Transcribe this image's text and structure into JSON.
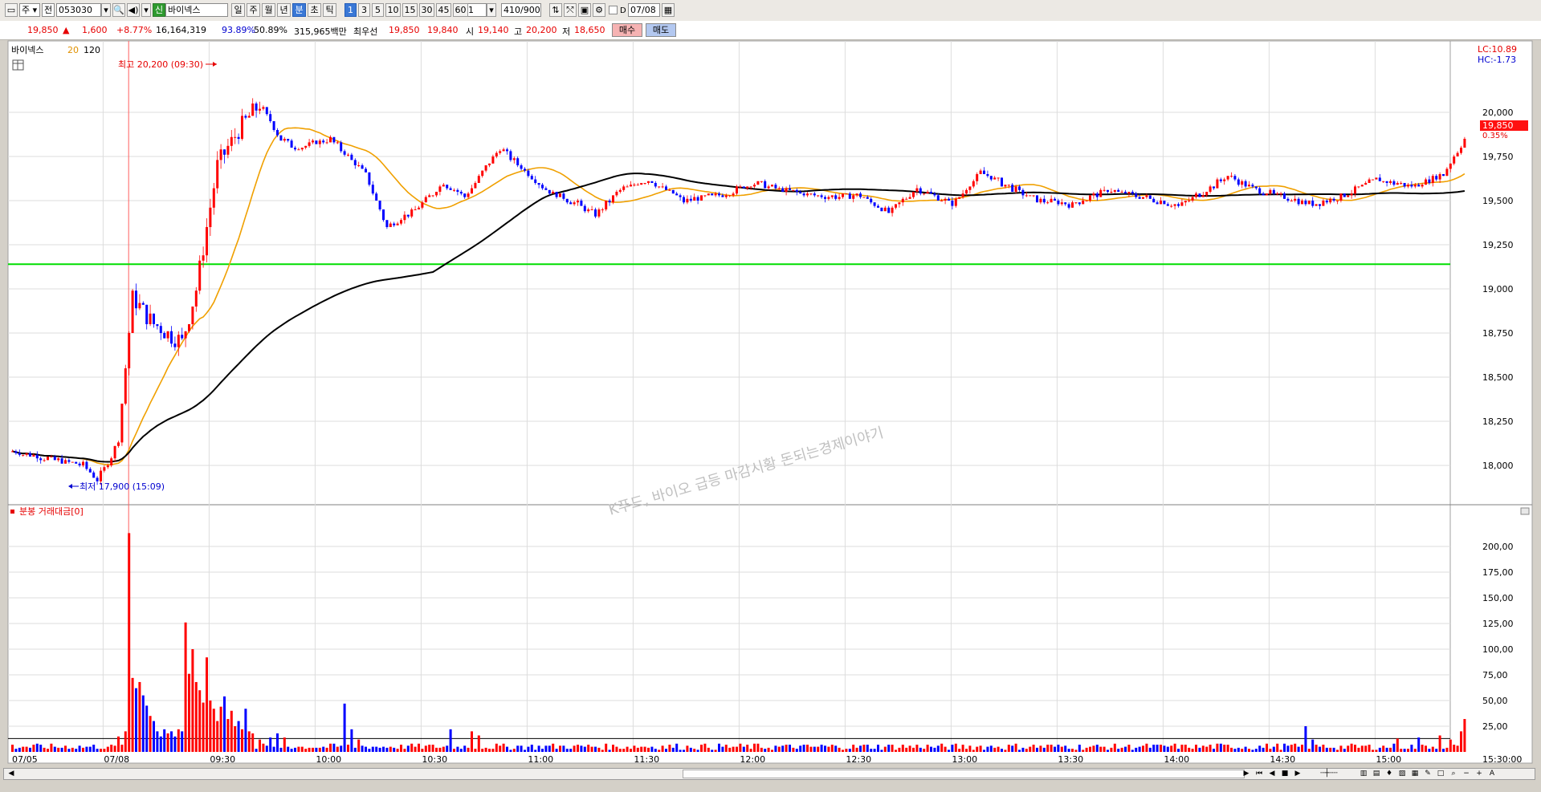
{
  "toolbar": {
    "market": "주",
    "type": "전",
    "code": "053030",
    "badge": "신",
    "name": "바이넥스",
    "periods": [
      "일",
      "주",
      "월",
      "년",
      "분",
      "초",
      "틱"
    ],
    "active_period": "분",
    "intervals": [
      "1",
      "3",
      "5",
      "10",
      "15",
      "30",
      "45",
      "60"
    ],
    "active_interval": "1",
    "unit_value": "1",
    "count": "410/900",
    "check_label": "D",
    "date": "07/08"
  },
  "info": {
    "price": "19,850",
    "arrow": "▲",
    "change": "1,600",
    "change_pct": "+8.77%",
    "volume": "16,164,319",
    "vol_ratio": "93.89%",
    "ratio2": "50.89%",
    "amount": "315,965백만",
    "bid_label": "최우선",
    "ask": "19,850",
    "bid": "19,840",
    "open_label": "시",
    "open": "19,140",
    "high_label": "고",
    "high": "20,200",
    "low_label": "저",
    "low": "18,650",
    "buy_label": "매수",
    "sell_label": "매도"
  },
  "legend": {
    "name": "바이넥스",
    "ma1": "20",
    "ma2": "120",
    "lc": "LC:10.89",
    "hc": "HC:-1.73",
    "cur_price": "19,850",
    "cur_pct": "0.35%"
  },
  "annotations": {
    "high": "최고 20,200 (09:30)",
    "low": "최저 17,900 (15:09)",
    "watermark": "K푸드, 바이오 급등 마감시황 돈되는경제이야기"
  },
  "volume_panel": {
    "title": "분봉 거래대금[0]"
  },
  "colors": {
    "up": "#ff0000",
    "down": "#0000ff",
    "ma20": "#f0a000",
    "ma120": "#000000",
    "hline": "#00dd00",
    "grid": "#dcdcdc"
  },
  "chart_data": {
    "type": "candlestick",
    "price_axis": {
      "ylim": [
        17850,
        20350
      ],
      "ticks": [
        18000,
        18250,
        18500,
        18750,
        19000,
        19250,
        19500,
        19750,
        20000
      ],
      "tick_labels": [
        "18,000",
        "18,250",
        "18,500",
        "18,750",
        "19,000",
        "19,250",
        "19,500",
        "19,750",
        "20,000"
      ]
    },
    "volume_axis": {
      "ylim": [
        0,
        225
      ],
      "ticks": [
        25,
        50,
        75,
        100,
        125,
        150,
        175,
        200
      ],
      "tick_labels": [
        "25,00",
        "50,00",
        "75,00",
        "100,00",
        "125,00",
        "150,00",
        "175,00",
        "200,00"
      ]
    },
    "x_labels": [
      "07/05",
      "07/08",
      "09:30",
      "10:00",
      "10:30",
      "11:00",
      "11:30",
      "12:00",
      "12:30",
      "13:00",
      "13:30",
      "14:00",
      "14:30",
      "15:00",
      "15:30:00"
    ],
    "horizontal_line": 19140,
    "volume_reference": 13,
    "price_path": [
      [
        0,
        18080
      ],
      [
        10,
        18040
      ],
      [
        20,
        18000
      ],
      [
        24,
        17920
      ],
      [
        28,
        18050
      ],
      [
        30,
        18150
      ],
      [
        34,
        18950
      ],
      [
        40,
        18800
      ],
      [
        48,
        18700
      ],
      [
        52,
        19000
      ],
      [
        58,
        19700
      ],
      [
        64,
        19900
      ],
      [
        70,
        20050
      ],
      [
        76,
        19850
      ],
      [
        80,
        19800
      ],
      [
        90,
        19850
      ],
      [
        100,
        19650
      ],
      [
        106,
        19350
      ],
      [
        114,
        19450
      ],
      [
        122,
        19600
      ],
      [
        128,
        19520
      ],
      [
        138,
        19800
      ],
      [
        146,
        19650
      ],
      [
        152,
        19550
      ],
      [
        160,
        19480
      ],
      [
        165,
        19420
      ],
      [
        172,
        19560
      ],
      [
        180,
        19620
      ],
      [
        190,
        19500
      ],
      [
        200,
        19530
      ],
      [
        210,
        19600
      ],
      [
        220,
        19550
      ],
      [
        230,
        19520
      ],
      [
        240,
        19530
      ],
      [
        248,
        19430
      ],
      [
        256,
        19570
      ],
      [
        266,
        19480
      ],
      [
        274,
        19660
      ],
      [
        282,
        19580
      ],
      [
        290,
        19500
      ],
      [
        300,
        19480
      ],
      [
        310,
        19560
      ],
      [
        320,
        19520
      ],
      [
        330,
        19470
      ],
      [
        338,
        19560
      ],
      [
        344,
        19640
      ],
      [
        352,
        19560
      ],
      [
        360,
        19520
      ],
      [
        368,
        19480
      ],
      [
        376,
        19520
      ],
      [
        386,
        19620
      ],
      [
        396,
        19580
      ],
      [
        405,
        19650
      ],
      [
        411,
        19850
      ]
    ],
    "volume_spikes": [
      {
        "bar": 30,
        "value": 15
      },
      {
        "bar": 32,
        "value": 20
      },
      {
        "bar": 33,
        "value": 213
      },
      {
        "bar": 34,
        "value": 72
      },
      {
        "bar": 35,
        "value": 62
      },
      {
        "bar": 36,
        "value": 68
      },
      {
        "bar": 37,
        "value": 55
      },
      {
        "bar": 38,
        "value": 45
      },
      {
        "bar": 39,
        "value": 35
      },
      {
        "bar": 40,
        "value": 30
      },
      {
        "bar": 41,
        "value": 20
      },
      {
        "bar": 42,
        "value": 15
      },
      {
        "bar": 43,
        "value": 22
      },
      {
        "bar": 44,
        "value": 18
      },
      {
        "bar": 45,
        "value": 20
      },
      {
        "bar": 46,
        "value": 15
      },
      {
        "bar": 47,
        "value": 22
      },
      {
        "bar": 48,
        "value": 20
      },
      {
        "bar": 49,
        "value": 126
      },
      {
        "bar": 50,
        "value": 76
      },
      {
        "bar": 51,
        "value": 100
      },
      {
        "bar": 52,
        "value": 68
      },
      {
        "bar": 53,
        "value": 60
      },
      {
        "bar": 54,
        "value": 48
      },
      {
        "bar": 55,
        "value": 92
      },
      {
        "bar": 56,
        "value": 50
      },
      {
        "bar": 57,
        "value": 42
      },
      {
        "bar": 58,
        "value": 30
      },
      {
        "bar": 59,
        "value": 44
      },
      {
        "bar": 60,
        "value": 54
      },
      {
        "bar": 61,
        "value": 32
      },
      {
        "bar": 62,
        "value": 40
      },
      {
        "bar": 63,
        "value": 25
      },
      {
        "bar": 64,
        "value": 30
      },
      {
        "bar": 65,
        "value": 22
      },
      {
        "bar": 66,
        "value": 42
      },
      {
        "bar": 67,
        "value": 20
      },
      {
        "bar": 68,
        "value": 18
      },
      {
        "bar": 70,
        "value": 12
      },
      {
        "bar": 73,
        "value": 14
      },
      {
        "bar": 75,
        "value": 18
      },
      {
        "bar": 77,
        "value": 14
      },
      {
        "bar": 94,
        "value": 47
      },
      {
        "bar": 96,
        "value": 22
      },
      {
        "bar": 98,
        "value": 12
      },
      {
        "bar": 124,
        "value": 22
      },
      {
        "bar": 130,
        "value": 20
      },
      {
        "bar": 132,
        "value": 16
      },
      {
        "bar": 366,
        "value": 25
      },
      {
        "bar": 368,
        "value": 12
      },
      {
        "bar": 392,
        "value": 13
      },
      {
        "bar": 398,
        "value": 14
      },
      {
        "bar": 404,
        "value": 16
      },
      {
        "bar": 407,
        "value": 12
      },
      {
        "bar": 410,
        "value": 20
      },
      {
        "bar": 411,
        "value": 32
      }
    ]
  }
}
